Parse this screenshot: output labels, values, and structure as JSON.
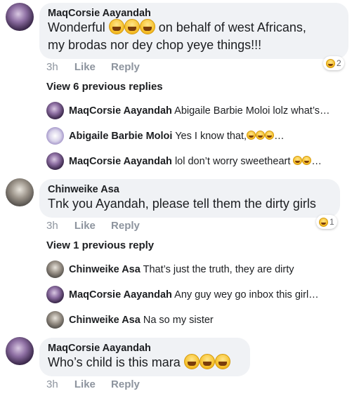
{
  "thread": [
    {
      "author": "MaqCorsie Aayandah",
      "text_parts": [
        "Wonderful ",
        " on behalf of west Africans,"
      ],
      "text_line2": "my brodas nor dey chop yeye things!!!",
      "time": "3h",
      "like": "Like",
      "reply": "Reply",
      "reaction_count": "2",
      "reaction_icon": "laugh-emoji-icon",
      "view_prev": "View 6 previous replies",
      "replies": [
        {
          "author": "MaqCorsie Aayandah",
          "text": "Abigaile Barbie Moloi  lolz what’s…"
        },
        {
          "author": "Abigaile Barbie Moloi",
          "text": "Yes I know that,",
          "suffix": "…"
        },
        {
          "author": "MaqCorsie Aayandah",
          "text": "lol don’t worry sweetheart",
          "suffix": "…"
        }
      ]
    },
    {
      "author": "Chinweike Asa",
      "text": "Tnk you Ayandah, please tell them the dirty girls",
      "time": "3h",
      "like": "Like",
      "reply": "Reply",
      "reaction_count": "1",
      "reaction_icon": "laugh-emoji-icon",
      "view_prev": "View 1 previous reply",
      "replies": [
        {
          "author": "Chinweike Asa",
          "text": "That’s just the truth,  they are dirty"
        },
        {
          "author": "MaqCorsie Aayandah",
          "text": "Any guy wey go inbox this girl…"
        },
        {
          "author": "Chinweike Asa",
          "text": "Na so my sister"
        }
      ]
    },
    {
      "author": "MaqCorsie Aayandah",
      "text": "Who’s child is this mara",
      "time": "3h",
      "like": "Like",
      "reply": "Reply"
    }
  ],
  "colors": {
    "bubble": "#f0f2f5",
    "meta": "#8d949e",
    "text": "#1c1e21"
  }
}
